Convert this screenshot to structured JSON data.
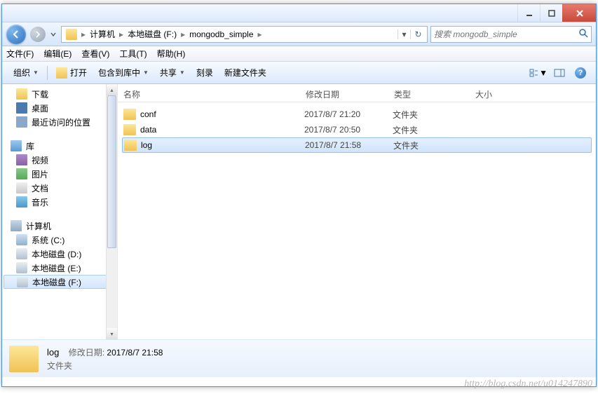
{
  "titlebar": {},
  "breadcrumb": {
    "items": [
      "计算机",
      "本地磁盘 (F:)",
      "mongodb_simple"
    ]
  },
  "search": {
    "placeholder": "搜索 mongodb_simple"
  },
  "menubar": {
    "file": "文件(F)",
    "edit": "编辑(E)",
    "view": "查看(V)",
    "tools": "工具(T)",
    "help": "帮助(H)"
  },
  "toolbar": {
    "organize": "组织",
    "open": "打开",
    "includeLib": "包含到库中",
    "share": "共享",
    "burn": "刻录",
    "newFolder": "新建文件夹"
  },
  "sidebar": {
    "downloads": "下载",
    "desktop": "桌面",
    "recent": "最近访问的位置",
    "libraries": "库",
    "videos": "视频",
    "pictures": "图片",
    "documents": "文档",
    "music": "音乐",
    "computer": "计算机",
    "driveC": "系统 (C:)",
    "driveD": "本地磁盘 (D:)",
    "driveE": "本地磁盘 (E:)",
    "driveF": "本地磁盘 (F:)"
  },
  "columns": {
    "name": "名称",
    "date": "修改日期",
    "type": "类型",
    "size": "大小"
  },
  "files": [
    {
      "name": "conf",
      "date": "2017/8/7 21:20",
      "type": "文件夹",
      "selected": false
    },
    {
      "name": "data",
      "date": "2017/8/7 20:50",
      "type": "文件夹",
      "selected": false
    },
    {
      "name": "log",
      "date": "2017/8/7 21:58",
      "type": "文件夹",
      "selected": true
    }
  ],
  "details": {
    "name": "log",
    "type": "文件夹",
    "dateLabel": "修改日期:",
    "date": "2017/8/7 21:58"
  },
  "watermark": "http://blog.csdn.net/u014247890"
}
